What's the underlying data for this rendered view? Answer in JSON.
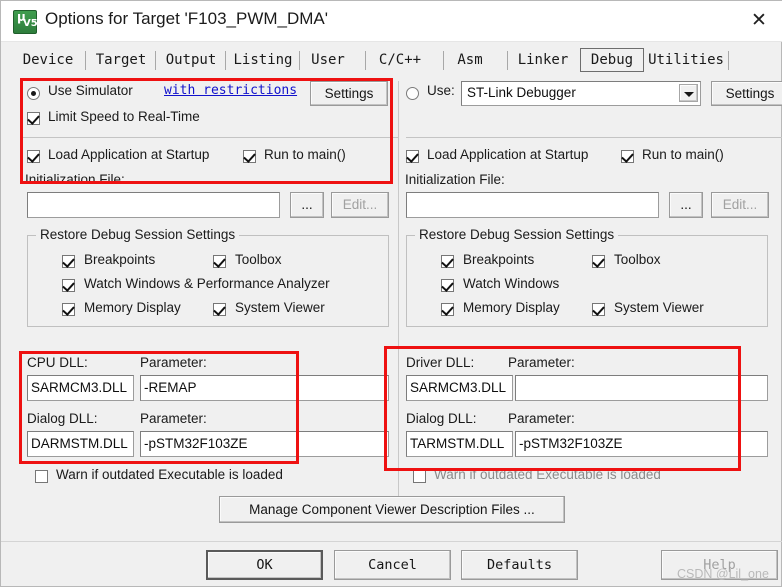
{
  "window": {
    "title": "Options for Target 'F103_PWM_DMA'",
    "icon": "uvision-icon",
    "icon_mu": "µ",
    "icon_v5": "V5",
    "close_label": "✕"
  },
  "tabs": [
    {
      "label": "Device",
      "selected": false
    },
    {
      "label": "Target",
      "selected": false
    },
    {
      "label": "Output",
      "selected": false
    },
    {
      "label": "Listing",
      "selected": false
    },
    {
      "label": "User",
      "selected": false
    },
    {
      "label": "C/C++",
      "selected": false
    },
    {
      "label": "Asm",
      "selected": false
    },
    {
      "label": "Linker",
      "selected": false
    },
    {
      "label": "Debug",
      "selected": true
    },
    {
      "label": "Utilities",
      "selected": false
    }
  ],
  "left_panel": {
    "use_simulator": {
      "label": "Use Simulator",
      "selected": true,
      "link_label": "with restrictions"
    },
    "settings_button": "Settings",
    "limit_speed": {
      "label": "Limit Speed to Real-Time",
      "checked": true
    },
    "load_app": {
      "label": "Load Application at Startup",
      "checked": true
    },
    "run_to_main": {
      "label": "Run to main()",
      "checked": true
    },
    "init_file_label": "Initialization File:",
    "init_file_value": "",
    "browse_button": "...",
    "edit_button": "Edit...",
    "restore_group": {
      "title": "Restore Debug Session Settings",
      "items": [
        {
          "label": "Breakpoints",
          "checked": true
        },
        {
          "label": "Toolbox",
          "checked": true
        },
        {
          "label": "Watch Windows & Performance Analyzer",
          "checked": true
        },
        {
          "label": "Memory Display",
          "checked": true
        },
        {
          "label": "System Viewer",
          "checked": true
        }
      ]
    },
    "cpu_dll_label": "CPU DLL:",
    "cpu_dll_value": "SARMCM3.DLL",
    "cpu_param_label": "Parameter:",
    "cpu_param_value": "-REMAP",
    "dialog_dll_label": "Dialog DLL:",
    "dialog_dll_value": "DARMSTM.DLL",
    "dialog_param_label": "Parameter:",
    "dialog_param_value": "-pSTM32F103ZE",
    "warn_outdated": {
      "label": "Warn if outdated Executable is loaded",
      "checked": false
    }
  },
  "right_panel": {
    "use_driver": {
      "label": "Use:",
      "selected": false,
      "driver_value": "ST-Link Debugger"
    },
    "settings_button": "Settings",
    "load_app": {
      "label": "Load Application at Startup",
      "checked": true
    },
    "run_to_main": {
      "label": "Run to main()",
      "checked": true
    },
    "init_file_label": "Initialization File:",
    "init_file_value": "",
    "browse_button": "...",
    "edit_button": "Edit...",
    "restore_group": {
      "title": "Restore Debug Session Settings",
      "items": [
        {
          "label": "Breakpoints",
          "checked": true
        },
        {
          "label": "Toolbox",
          "checked": true
        },
        {
          "label": "Watch Windows",
          "checked": true
        },
        {
          "label": "Memory Display",
          "checked": true
        },
        {
          "label": "System Viewer",
          "checked": true
        }
      ]
    },
    "driver_dll_label": "Driver DLL:",
    "driver_dll_value": "SARMCM3.DLL",
    "driver_param_label": "Parameter:",
    "driver_param_value": "",
    "dialog_dll_label": "Dialog DLL:",
    "dialog_dll_value": "TARMSTM.DLL",
    "dialog_param_label": "Parameter:",
    "dialog_param_value": "-pSTM32F103ZE",
    "warn_outdated": {
      "label": "Warn if outdated Executable is loaded",
      "checked": false
    }
  },
  "manage_button": "Manage Component Viewer Description Files ...",
  "footer": {
    "ok": "OK",
    "cancel": "Cancel",
    "defaults": "Defaults",
    "help": "Help"
  },
  "annotations": {
    "accent_color": "#ee1111",
    "boxes": [
      {
        "name": "simulator-options-highlight"
      },
      {
        "name": "cpu-dll-highlight"
      },
      {
        "name": "driver-dll-highlight"
      }
    ]
  },
  "watermark": "CSDN @Lil_one"
}
